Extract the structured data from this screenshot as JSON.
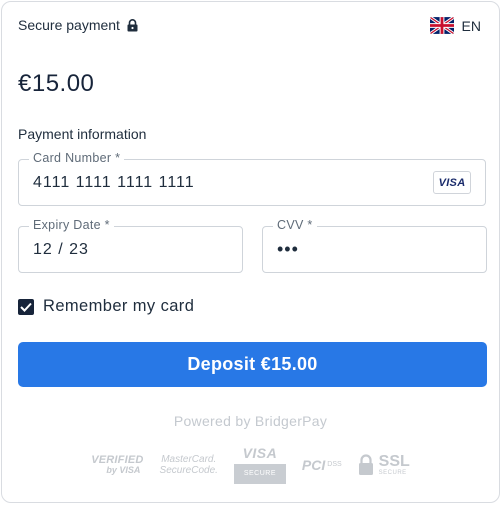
{
  "header": {
    "secure_label": "Secure payment",
    "secure_icon": "lock-icon",
    "language": "EN",
    "language_icon": "uk-flag-icon"
  },
  "amount": "€15.00",
  "form": {
    "section_title": "Payment information",
    "card_number": {
      "label": "Card Number *",
      "value": "4111 1111 1111 1111",
      "brand_badge": "VISA"
    },
    "expiry": {
      "label": "Expiry Date *",
      "value": "12 / 23"
    },
    "cvv": {
      "label": "CVV *",
      "value": "•••"
    },
    "remember": {
      "label": "Remember my card",
      "checked": true
    }
  },
  "deposit_button": {
    "label": "Deposit €15.00",
    "color": "#2878e6"
  },
  "footer": {
    "powered_by": "Powered by BridgerPay",
    "trust_logos": {
      "verified_by_visa": {
        "line1": "VERIFIED",
        "line2": "by VISA"
      },
      "mastercard_securecode": {
        "line1": "MasterCard.",
        "line2": "SecureCode."
      },
      "visa_secure": {
        "line1": "VISA",
        "line2": "SECURE"
      },
      "pci_dss": {
        "word": "PCI",
        "small": "DSS"
      },
      "ssl_secure": {
        "word": "SSL",
        "small": "SECURE"
      }
    }
  }
}
